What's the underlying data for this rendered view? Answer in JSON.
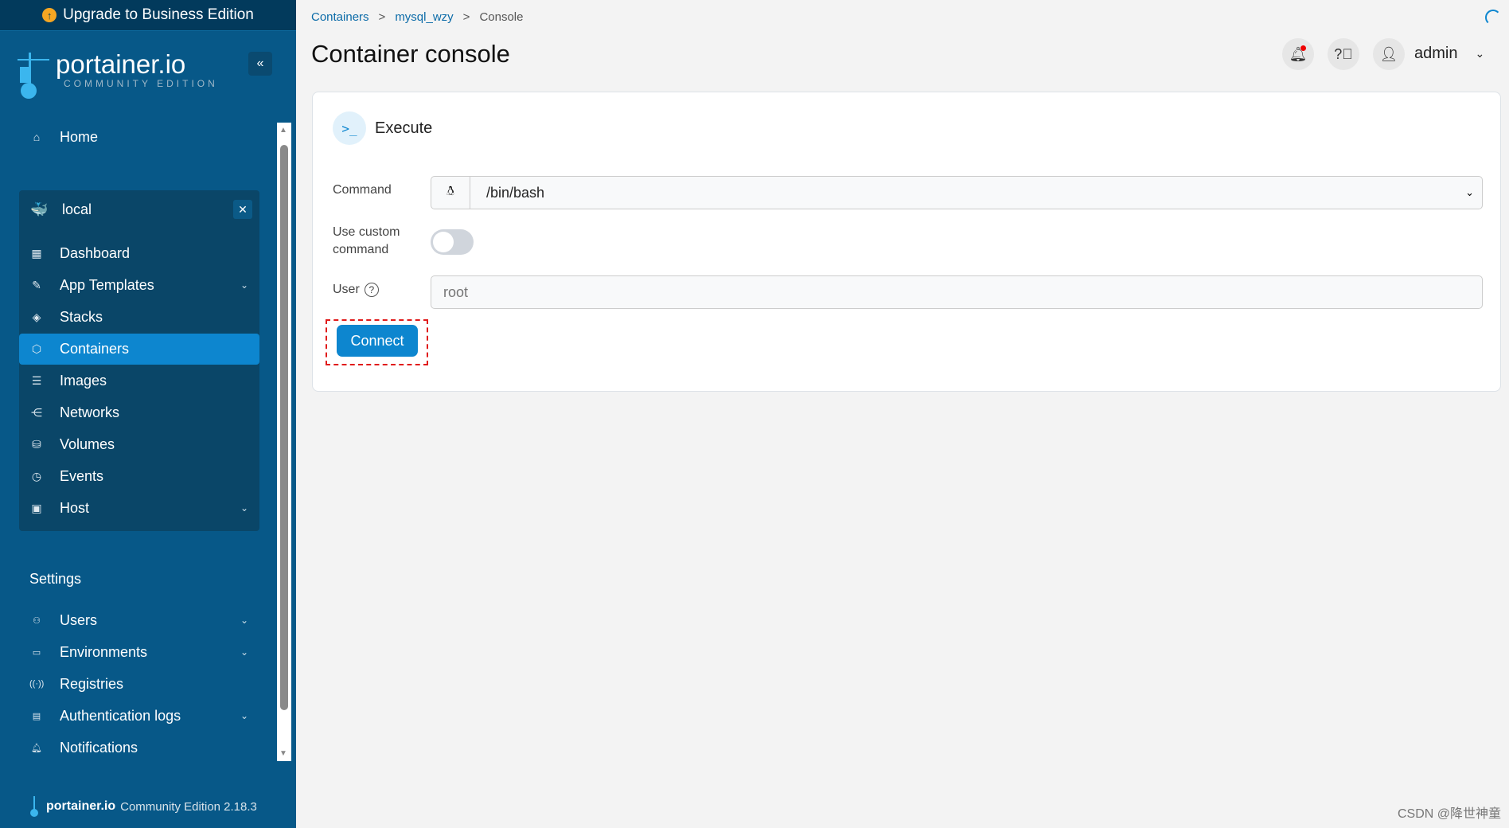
{
  "upgrade": {
    "label": "Upgrade to Business Edition"
  },
  "logo": {
    "word": "portainer.io",
    "sub": "COMMUNITY EDITION"
  },
  "nav": {
    "home": "Home",
    "env_name": "local",
    "env_items": [
      {
        "label": "Dashboard",
        "icon": "dashboard-icon"
      },
      {
        "label": "App Templates",
        "icon": "edit-icon",
        "chevron": true
      },
      {
        "label": "Stacks",
        "icon": "layers-icon"
      },
      {
        "label": "Containers",
        "icon": "box-icon",
        "active": true
      },
      {
        "label": "Images",
        "icon": "list-icon"
      },
      {
        "label": "Networks",
        "icon": "share-icon"
      },
      {
        "label": "Volumes",
        "icon": "database-icon"
      },
      {
        "label": "Events",
        "icon": "clock-icon"
      },
      {
        "label": "Host",
        "icon": "server-icon",
        "chevron": true
      }
    ],
    "settings_title": "Settings",
    "settings_items": [
      {
        "label": "Users",
        "chevron": true
      },
      {
        "label": "Environments",
        "chevron": true
      },
      {
        "label": "Registries"
      },
      {
        "label": "Authentication logs",
        "chevron": true
      },
      {
        "label": "Notifications"
      }
    ]
  },
  "footer": {
    "brand": "portainer.io",
    "edition": "Community Edition 2.18.3"
  },
  "breadcrumb": [
    "Containers",
    "mysql_wzy",
    "Console"
  ],
  "title": "Container console",
  "user": "admin",
  "card": {
    "heading": "Execute",
    "command_label": "Command",
    "command_value": "/bin/bash",
    "custom_label": "Use custom command",
    "custom_enabled": false,
    "user_label": "User",
    "user_placeholder": "root",
    "connect": "Connect"
  },
  "watermark": "CSDN @降世神童",
  "colors": {
    "sidebar": "#075888",
    "accent": "#0d86cf",
    "highlight": "#e00000"
  }
}
